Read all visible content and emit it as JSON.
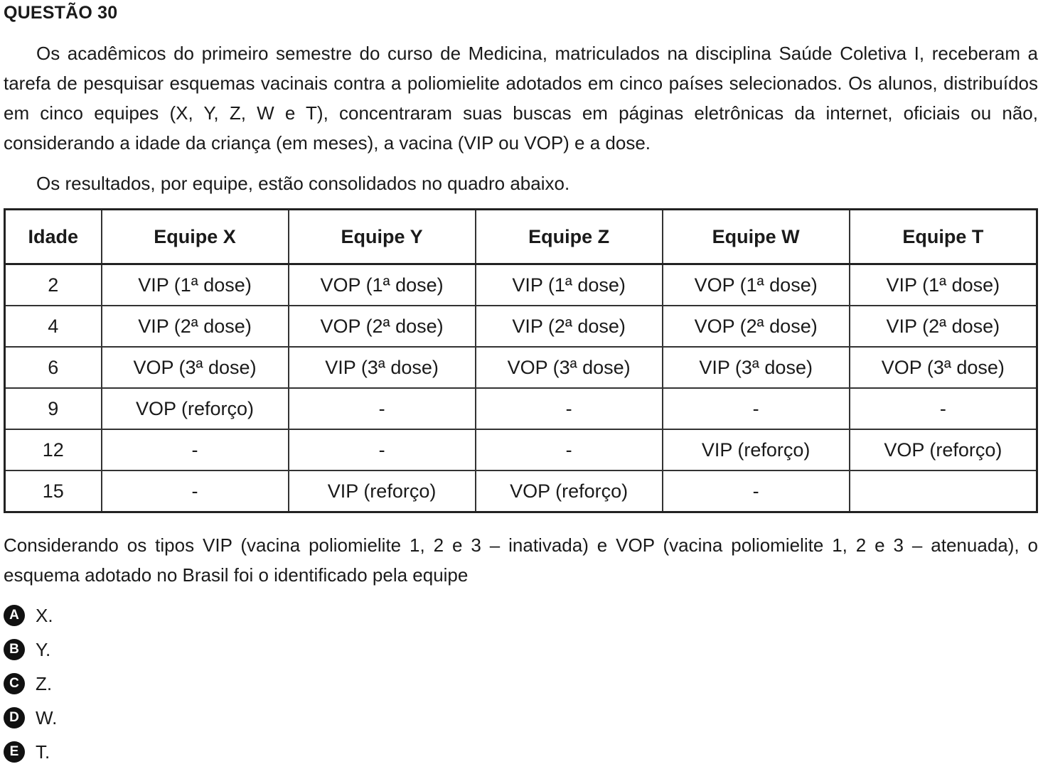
{
  "question": {
    "title": "QUESTÃO 30",
    "intro": "Os acadêmicos do primeiro semestre do curso de Medicina, matriculados na disciplina Saúde Coletiva I, receberam a tarefa de pesquisar esquemas vacinais contra a poliomielite adotados em cinco países selecionados. Os alunos, distribuídos em cinco equipes (X, Y, Z, W e T), concentraram suas buscas em páginas eletrônicas da internet, oficiais ou não, considerando a idade da criança (em meses), a vacina (VIP ou VOP) e a dose.",
    "table_intro": "Os resultados, por equipe, estão consolidados no quadro abaixo.",
    "prompt": "Considerando os tipos VIP (vacina poliomielite 1, 2 e 3 – inativada) e VOP (vacina poliomielite 1, 2 e 3 – atenuada), o esquema adotado no Brasil foi o identificado pela equipe"
  },
  "table": {
    "headers": [
      "Idade",
      "Equipe X",
      "Equipe Y",
      "Equipe Z",
      "Equipe W",
      "Equipe T"
    ],
    "rows": [
      [
        "2",
        "VIP (1ª dose)",
        "VOP (1ª dose)",
        "VIP (1ª dose)",
        "VOP (1ª dose)",
        "VIP (1ª dose)"
      ],
      [
        "4",
        "VIP (2ª dose)",
        "VOP (2ª dose)",
        "VIP (2ª dose)",
        "VOP (2ª dose)",
        "VIP (2ª dose)"
      ],
      [
        "6",
        "VOP (3ª dose)",
        "VIP (3ª dose)",
        "VOP (3ª dose)",
        "VIP (3ª dose)",
        "VOP (3ª dose)"
      ],
      [
        "9",
        "VOP (reforço)",
        "-",
        "-",
        "-",
        "-"
      ],
      [
        "12",
        "-",
        "-",
        "-",
        "VIP (reforço)",
        "VOP (reforço)"
      ],
      [
        "15",
        "-",
        "VIP (reforço)",
        "VOP (reforço)",
        "-",
        ""
      ]
    ]
  },
  "options": [
    {
      "letter": "A",
      "text": "X."
    },
    {
      "letter": "B",
      "text": "Y."
    },
    {
      "letter": "C",
      "text": "Z."
    },
    {
      "letter": "D",
      "text": "W."
    },
    {
      "letter": "E",
      "text": "T."
    }
  ]
}
